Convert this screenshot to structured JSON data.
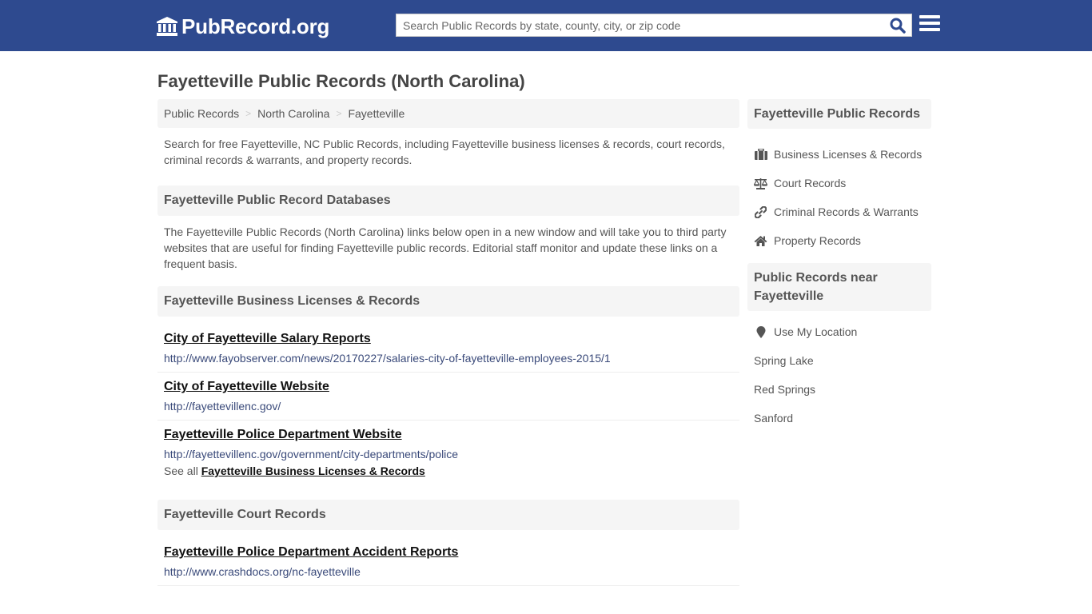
{
  "header": {
    "logo_text": "PubRecord.org",
    "search_placeholder": "Search Public Records by state, county, city, or zip code",
    "brand_color": "#2e4a8f",
    "search_icon": "search-icon",
    "menu_icon": "hamburger-menu-icon"
  },
  "page": {
    "title": "Fayetteville Public Records (North Carolina)"
  },
  "breadcrumb": [
    {
      "label": "Public Records"
    },
    {
      "label": "North Carolina"
    },
    {
      "label": "Fayetteville"
    }
  ],
  "intro": "Search for free Fayetteville, NC Public Records, including Fayetteville business licenses & records, court records, criminal records & warrants, and property records.",
  "databases": {
    "heading": "Fayetteville Public Record Databases",
    "description": "The Fayetteville Public Records (North Carolina) links below open in a new window and will take you to third party websites that are useful for finding Fayetteville public records. Editorial staff monitor and update these links on a frequent basis."
  },
  "sections": [
    {
      "heading": "Fayetteville Business Licenses & Records",
      "links": [
        {
          "title": "City of Fayetteville Salary Reports",
          "url": "http://www.fayobserver.com/news/20170227/salaries-city-of-fayetteville-employees-2015/1"
        },
        {
          "title": "City of Fayetteville Website",
          "url": "http://fayettevillenc.gov/"
        },
        {
          "title": "Fayetteville Police Department Website",
          "url": "http://fayettevillenc.gov/government/city-departments/police"
        }
      ],
      "see_all_prefix": "See all",
      "see_all_link": "Fayetteville Business Licenses & Records"
    },
    {
      "heading": "Fayetteville Court Records",
      "links": [
        {
          "title": "Fayetteville Police Department Accident Reports",
          "url": "http://www.crashdocs.org/nc-fayetteville"
        }
      ]
    }
  ],
  "sidebar": {
    "records_heading": "Fayetteville Public Records",
    "records_items": [
      {
        "label": "Business Licenses & Records",
        "icon": "briefcase-icon"
      },
      {
        "label": "Court Records",
        "icon": "balance-scale-icon"
      },
      {
        "label": "Criminal Records & Warrants",
        "icon": "link-icon"
      },
      {
        "label": "Property Records",
        "icon": "home-icon"
      }
    ],
    "nearby_heading": "Public Records near Fayetteville",
    "location_item": {
      "label": "Use My Location",
      "icon": "map-marker-icon"
    },
    "nearby_items": [
      {
        "label": "Spring Lake"
      },
      {
        "label": "Red Springs"
      },
      {
        "label": "Sanford"
      }
    ]
  }
}
